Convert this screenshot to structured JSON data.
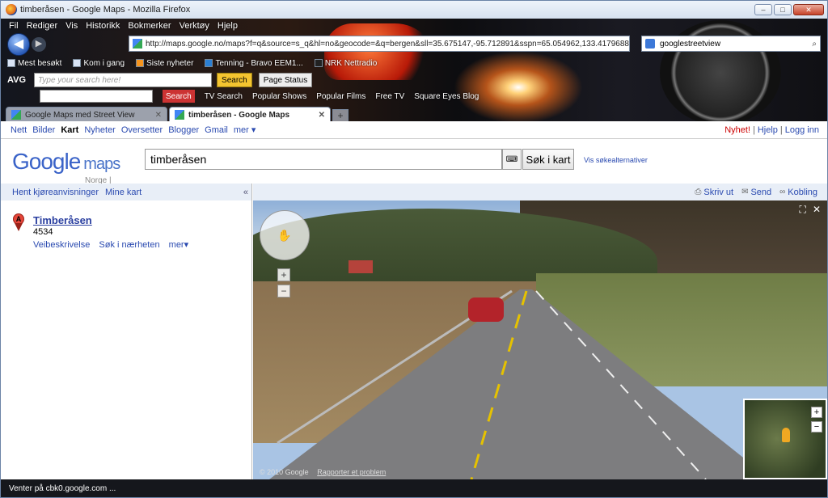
{
  "window": {
    "title": "timberåsen - Google Maps - Mozilla Firefox",
    "buttons": {
      "minimize": "–",
      "maximize": "□",
      "close": "✕"
    }
  },
  "menu": [
    "Fil",
    "Rediger",
    "Vis",
    "Historikk",
    "Bokmerker",
    "Verktøy",
    "Hjelp"
  ],
  "nav": {
    "url": "http://maps.google.no/maps?f=q&source=s_q&hl=no&geocode=&q=bergen&sll=35.675147,-95.712891&sspn=65.054962,133.4179688",
    "search_value": "googlestreetview",
    "back_glyph": "◀",
    "forward_glyph": "▶"
  },
  "bookmarks": [
    "Mest besøkt",
    "Kom i gang",
    "Siste nyheter",
    "Tenning - Bravo EEM1...",
    "NRK Nettradio"
  ],
  "avg_toolbar": {
    "brand": "AVG",
    "search_placeholder": "Type your search here!",
    "search_button": "Search",
    "page_status": "Page Status"
  },
  "extra_toolbar": {
    "search": "Search",
    "items": [
      "TV Search",
      "Popular Shows",
      "Popular Films",
      "Free TV",
      "Square Eyes Blog"
    ]
  },
  "tabs": [
    {
      "label": "Google Maps med Street View",
      "active": false
    },
    {
      "label": "timberåsen - Google Maps",
      "active": true
    }
  ],
  "new_tab": "+",
  "google_bar": {
    "links": [
      "Nett",
      "Bilder",
      "Kart",
      "Nyheter",
      "Oversetter",
      "Blogger",
      "Gmail",
      "mer ▾"
    ],
    "current": "Kart",
    "right": {
      "nyhet": "Nyhet!",
      "help": "Hjelp",
      "login": "Logg inn",
      "sep": "|"
    }
  },
  "header": {
    "logo_google": "Google",
    "logo_maps": "maps",
    "logo_sub": "Norge | beta",
    "query": "timberåsen",
    "keyboard_glyph": "⌨",
    "search_button": "Søk i kart",
    "options_link": "Vis søkealternativer"
  },
  "left_panel": {
    "links": [
      "Hent kjøreanvisninger",
      "Mine kart"
    ],
    "collapse": "«",
    "result": {
      "marker": "A",
      "title": "Timberåsen",
      "postcode": "4534",
      "links": [
        "Veibeskrivelse",
        "Søk i nærheten",
        "mer▾"
      ]
    }
  },
  "map_header": {
    "print": "Skriv ut",
    "send": "Send",
    "link": "Kobling"
  },
  "streetview": {
    "copyright": "© 2010 Google",
    "report": "Rapporter et problem",
    "zoom_in": "+",
    "zoom_out": "−",
    "expand": "⛶",
    "close": "✕"
  },
  "status": "Venter på cbk0.google.com ..."
}
